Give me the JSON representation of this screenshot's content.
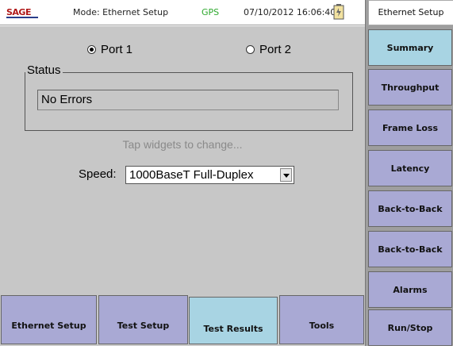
{
  "header": {
    "logo": "SAGE",
    "mode_label": "Mode: Ethernet Setup",
    "gps": "GPS",
    "datetime": "07/10/2012 16:06:40"
  },
  "ports": {
    "port1_label": "Port 1",
    "port2_label": "Port 2",
    "selected": "Port 1"
  },
  "status": {
    "legend": "Status",
    "value": "No Errors"
  },
  "hint": "Tap widgets to change...",
  "speed": {
    "label": "Speed:",
    "value": "1000BaseT Full-Duplex"
  },
  "bottom_nav": {
    "items": [
      {
        "label": "Ethernet Setup"
      },
      {
        "label": "Test Setup"
      },
      {
        "label": "Test Results"
      },
      {
        "label": "Tools"
      }
    ],
    "active": "Test Results"
  },
  "sidebar": {
    "title": "Ethernet Setup",
    "items": [
      {
        "label": "Summary"
      },
      {
        "label": "Throughput"
      },
      {
        "label": "Frame Loss"
      },
      {
        "label": "Latency"
      },
      {
        "label": "Back-to-Back"
      },
      {
        "label": "Back-to-Back"
      },
      {
        "label": "Alarms"
      },
      {
        "label": "Run/Stop"
      }
    ],
    "active": "Summary"
  },
  "colors": {
    "button": "#a9a9d4",
    "button_active": "#a8d4e3",
    "panel": "#c7c7c7",
    "gps": "#2ea82e",
    "logo": "#b01818"
  }
}
